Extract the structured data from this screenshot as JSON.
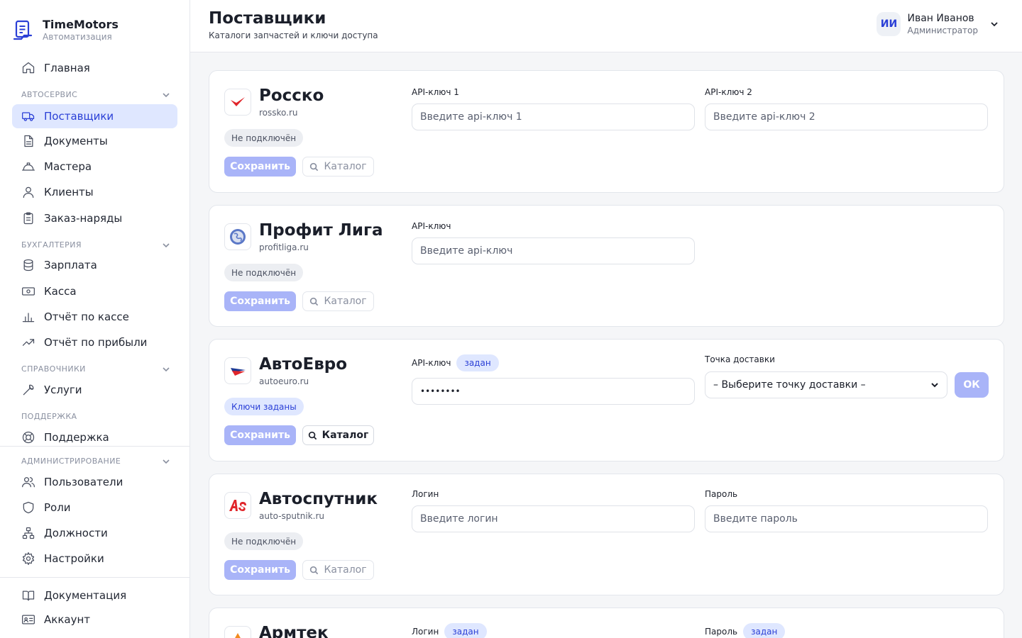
{
  "brand": {
    "name": "TimeMotors",
    "subtitle": "Автоматизация"
  },
  "sidebar": {
    "home": "Главная",
    "sections": [
      {
        "label": "АВТОСЕРВИС",
        "items": [
          "Поставщики",
          "Документы",
          "Мастера",
          "Клиенты",
          "Заказ-наряды"
        ]
      },
      {
        "label": "БУХГАЛТЕРИЯ",
        "items": [
          "Зарплата",
          "Касса",
          "Отчёт по кассе",
          "Отчёт по прибыли"
        ]
      },
      {
        "label": "СПРАВОЧНИКИ",
        "items": [
          "Услуги"
        ]
      },
      {
        "label": "ПОДДЕРЖКА",
        "items": [
          "Поддержка"
        ]
      },
      {
        "label": "АДМИНИСТРИРОВАНИЕ",
        "items": [
          "Пользователи",
          "Роли",
          "Должности",
          "Настройки"
        ]
      }
    ],
    "footer": [
      "Документация",
      "Аккаунт"
    ],
    "active": "Поставщики"
  },
  "header": {
    "title": "Поставщики",
    "subtitle": "Каталоги запчастей и ключи доступа",
    "user": {
      "initials": "ИИ",
      "name": "Иван Иванов",
      "role": "Администратор"
    }
  },
  "common": {
    "save_label": "Сохранить",
    "catalog_label": "Каталог",
    "set_tag": "задан",
    "ok_label": "ОК"
  },
  "suppliers": [
    {
      "name": "Росско",
      "domain": "rossko.ru",
      "status": "Не подключён",
      "fields": [
        {
          "label": "API-ключ 1",
          "placeholder": "Введите api-ключ 1"
        },
        {
          "label": "API-ключ 2",
          "placeholder": "Введите api-ключ 2"
        }
      ]
    },
    {
      "name": "Профит Лига",
      "domain": "profitliga.ru",
      "status": "Не подключён",
      "fields": [
        {
          "label": "API-ключ",
          "placeholder": "Введите api-ключ"
        }
      ]
    },
    {
      "name": "АвтоЕвро",
      "domain": "autoeuro.ru",
      "status": "Ключи заданы",
      "fields": [
        {
          "label": "API-ключ",
          "value": "••••••••"
        }
      ],
      "delivery": {
        "label": "Точка доставки",
        "selected": "– Выберите точку доставки –"
      }
    },
    {
      "name": "Автоспутник",
      "domain": "auto-sputnik.ru",
      "status": "Не подключён",
      "fields": [
        {
          "label": "Логин",
          "placeholder": "Введите логин"
        },
        {
          "label": "Пароль",
          "placeholder": "Введите пароль"
        }
      ]
    },
    {
      "name": "Армтек",
      "fields": [
        {
          "label": "Логин"
        },
        {
          "label": "Пароль"
        }
      ]
    }
  ]
}
